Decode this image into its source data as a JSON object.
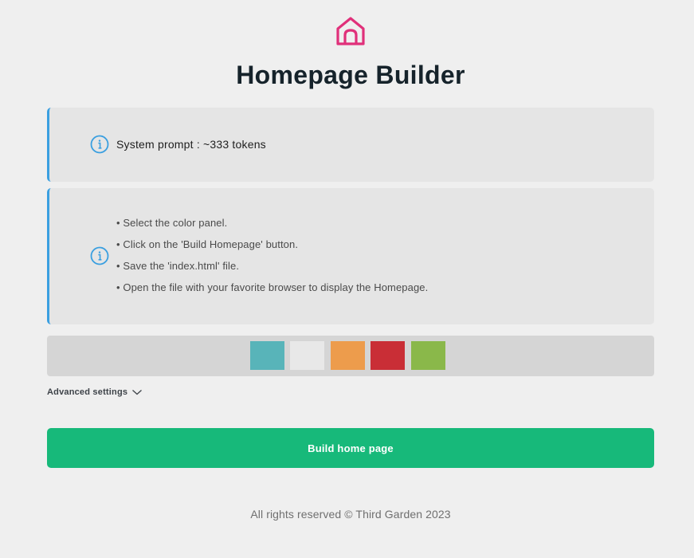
{
  "header": {
    "logo_icon": "home-icon",
    "logo_color": "#e0307a",
    "title": "Homepage Builder"
  },
  "prompt_info": {
    "icon": "info-icon",
    "text": "System prompt : ~333 tokens"
  },
  "instructions": {
    "icon": "info-icon",
    "steps": [
      "• Select the color panel.",
      "• Click on the 'Build Homepage' button.",
      "• Save the 'index.html' file.",
      "• Open the file with your favorite browser to display the Homepage."
    ]
  },
  "palette": {
    "colors": [
      "#58b4b9",
      "#e8e8e8",
      "#ed9c4c",
      "#c92e36",
      "#8ab84a"
    ]
  },
  "advanced_settings": {
    "label": "Advanced settings",
    "icon": "chevron-down-icon"
  },
  "build_button": {
    "label": "Build home page",
    "color": "#17b97a"
  },
  "footer": {
    "text": "All rights reserved © Third Garden 2023"
  },
  "accent_color": "#3a9fe0"
}
